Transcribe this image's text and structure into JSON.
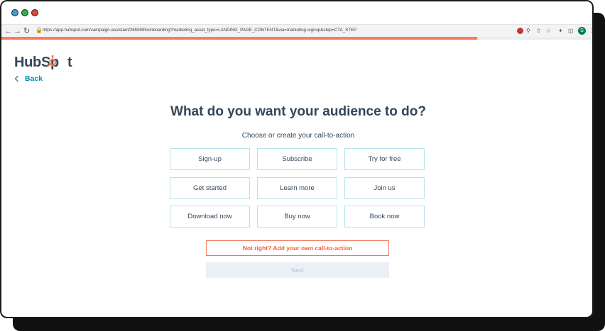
{
  "browser": {
    "url": "https://app.hubspot.com/campaign-assistant/2659995/onboarding?marketing_asset_type=LANDING_PAGE_CONTENT&via=marketing-signup&step=CTA_STEP",
    "avatar_letter": "S",
    "progress_fraction": 0.805
  },
  "logo": {
    "text_a": "HubSp",
    "text_b": "t"
  },
  "nav": {
    "back_label": "Back"
  },
  "page": {
    "heading": "What do you want your audience to do?",
    "subheading": "Choose or create your call-to-action"
  },
  "options": [
    "Sign-up",
    "Subscribe",
    "Try for free",
    "Get started",
    "Learn more",
    "Join us",
    "Download now",
    "Buy now",
    "Book now"
  ],
  "actions": {
    "own_cta_label": "Not right? Add your own call-to-action",
    "next_label": "Next"
  },
  "colors": {
    "brand_orange": "#ff7a59",
    "heading_text": "#33475b",
    "link_teal": "#0091ae",
    "option_border": "#b6e3ea"
  }
}
